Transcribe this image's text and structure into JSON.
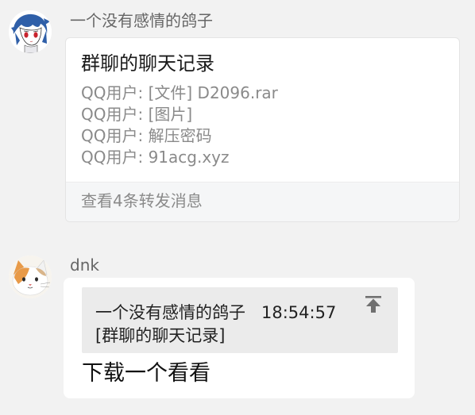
{
  "messages": [
    {
      "sender": "一个没有感情的鸽子",
      "avatar_icon": "anime-character-avatar-icon",
      "forward": {
        "title": "群聊的聊天记录",
        "lines": [
          "QQ用户: [文件] D2096.rar",
          "QQ用户: [图片]",
          "QQ用户: 解压密码",
          "QQ用户: 91acg.xyz"
        ],
        "footer": "查看4条转发消息"
      }
    },
    {
      "sender": "dnk",
      "avatar_icon": "cat-avatar-icon",
      "quote": {
        "author": "一个没有感情的鸽子",
        "time": "18:54:57",
        "content": "[群聊的聊天记录]",
        "jump_icon": "jump-to-top-icon"
      },
      "text": "下载一个看看"
    }
  ],
  "colors": {
    "background": "#f2f2f2",
    "bubble": "#ffffff",
    "quote_background": "#ebebeb",
    "forward_footer": "#f5f6f7",
    "secondary_text": "#8a8a8a"
  }
}
